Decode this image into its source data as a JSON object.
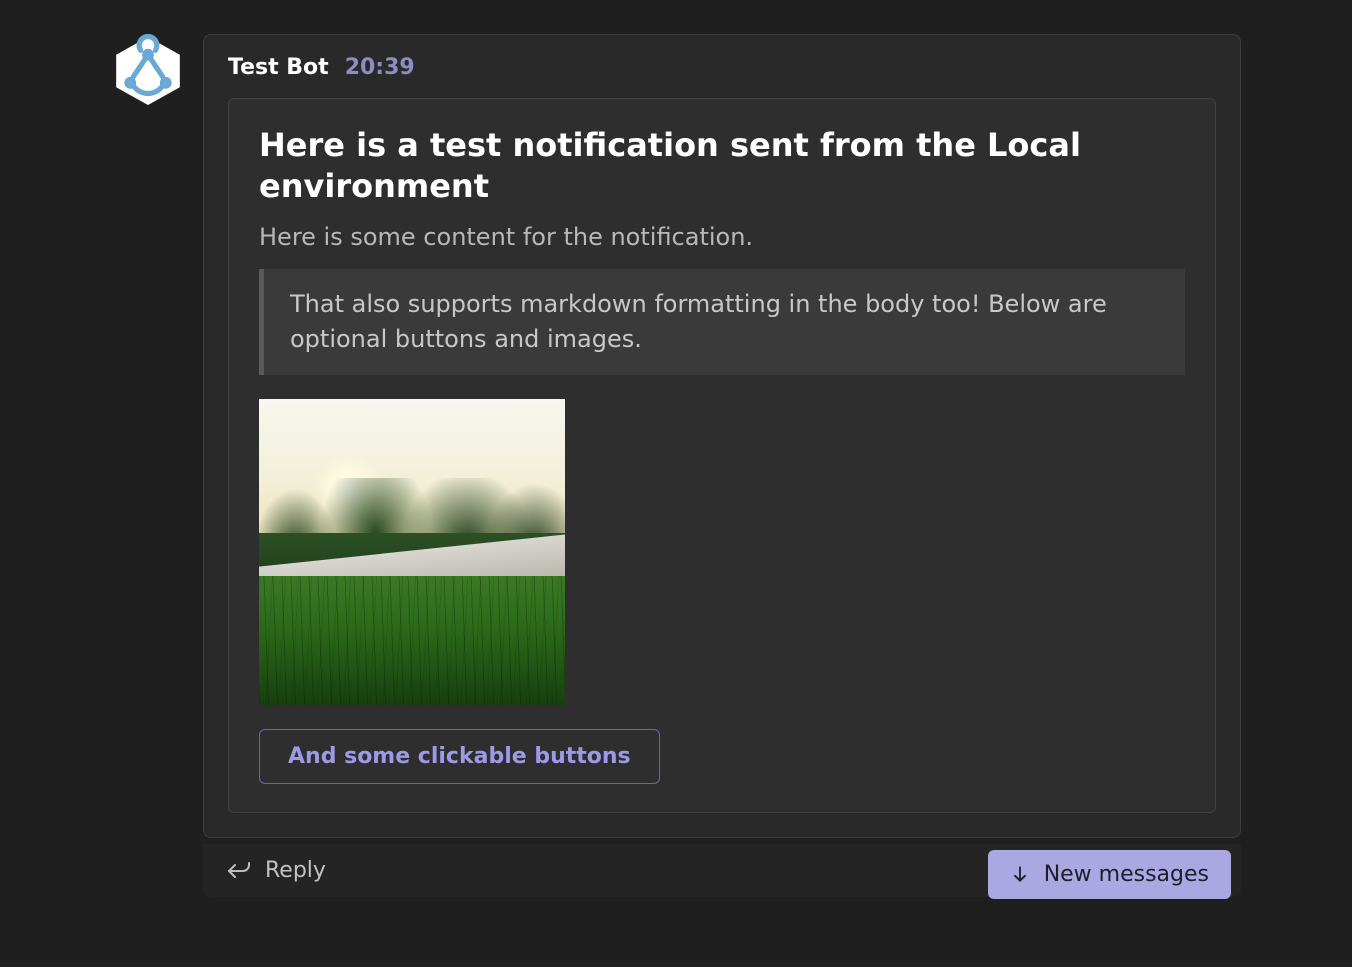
{
  "message": {
    "sender": "Test Bot",
    "timestamp": "20:39"
  },
  "card": {
    "title": "Here is a test notification sent from the Local environment",
    "subtitle": "Here is some content for the notification.",
    "blockquote": "That also supports markdown formatting in the body too! Below are optional buttons and images.",
    "button_label": "And some clickable buttons"
  },
  "reply": {
    "placeholder": "Reply"
  },
  "toast": {
    "label": "New messages"
  }
}
